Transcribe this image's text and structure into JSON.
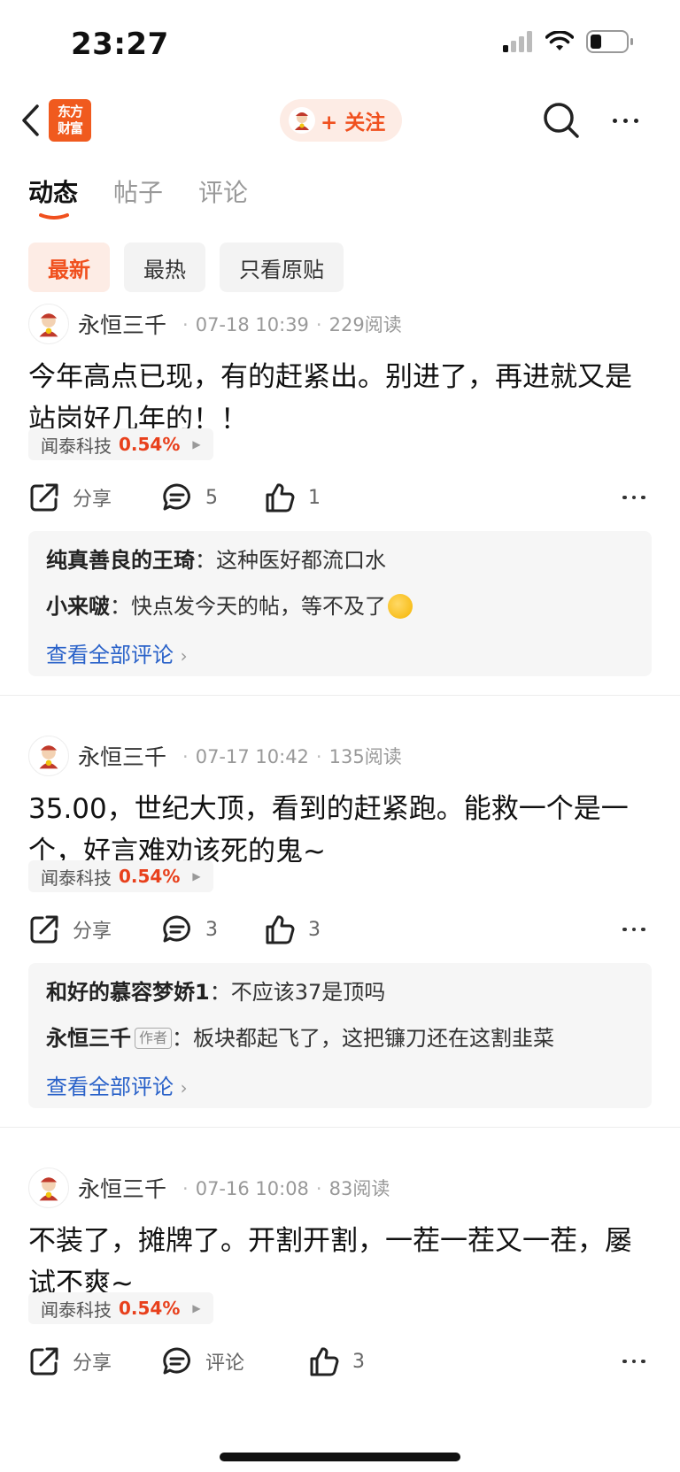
{
  "status": {
    "time": "23:27"
  },
  "nav": {
    "logo_text": "东方\n财富",
    "follow_label": "+ 关注"
  },
  "tabs": [
    {
      "label": "动态",
      "active": true
    },
    {
      "label": "帖子",
      "active": false
    },
    {
      "label": "评论",
      "active": false
    }
  ],
  "filters": [
    {
      "label": "最新",
      "active": true
    },
    {
      "label": "最热",
      "active": false
    },
    {
      "label": "只看原贴",
      "active": false
    }
  ],
  "colors": {
    "accent": "#f0501e",
    "link": "#2a62c9",
    "up": "#e8401c"
  },
  "posts": [
    {
      "author": "永恒三千",
      "date": "07-18 10:39",
      "reads": "229阅读",
      "body": "今年高点已现，有的赶紧出。别进了，再进就又是站岗好几年的！！",
      "stock": {
        "name": "闻泰科技",
        "change": "0.54%"
      },
      "share_label": "分享",
      "comment_count": "5",
      "like_count": "1",
      "comments": [
        {
          "author": "纯真善良的王琦",
          "text": "这种医好都流口水"
        },
        {
          "author": "小来啵",
          "text": "快点发今天的帖，等不及了"
        }
      ],
      "view_all": "查看全部评论"
    },
    {
      "author": "永恒三千",
      "date": "07-17 10:42",
      "reads": "135阅读",
      "body": "35.00，世纪大顶，看到的赶紧跑。能救一个是一个，好言难劝该死的鬼~",
      "stock": {
        "name": "闻泰科技",
        "change": "0.54%"
      },
      "share_label": "分享",
      "comment_count": "3",
      "like_count": "3",
      "comments": [
        {
          "author": "和好的慕容梦娇1",
          "text": "不应该37是顶吗"
        },
        {
          "author": "永恒三千",
          "badge": "作者",
          "text": "板块都起飞了，这把镰刀还在这割韭菜"
        }
      ],
      "view_all": "查看全部评论"
    },
    {
      "author": "永恒三千",
      "date": "07-16 10:08",
      "reads": "83阅读",
      "body": "不装了，摊牌了。开割开割，一茬一茬又一茬，屡试不爽~",
      "stock": {
        "name": "闻泰科技",
        "change": "0.54%"
      },
      "share_label": "分享",
      "comment_label": "评论",
      "like_count": "3"
    }
  ]
}
